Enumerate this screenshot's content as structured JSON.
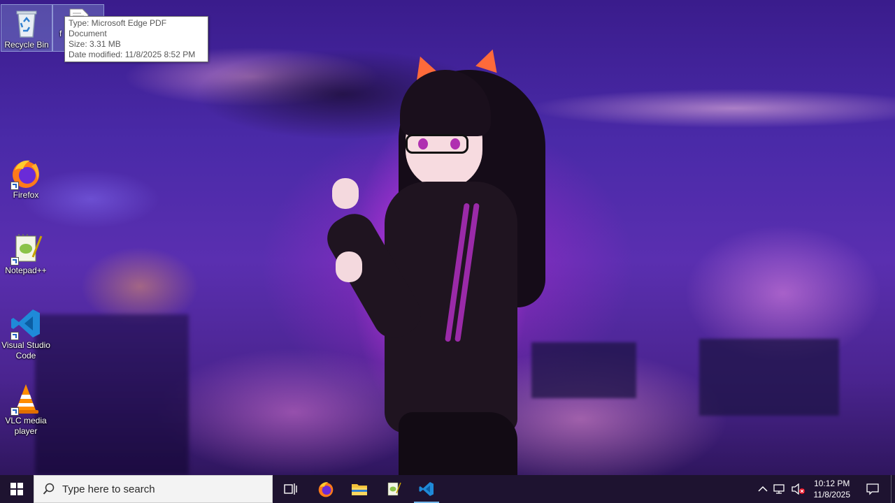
{
  "desktop": {
    "icons": [
      {
        "label": "Recycle Bin",
        "icon": "recycle-bin-icon"
      },
      {
        "label": "f",
        "icon": "pdf-file-icon"
      },
      {
        "label": "Firefox",
        "icon": "firefox-icon"
      },
      {
        "label": "Notepad++",
        "icon": "notepadpp-icon"
      },
      {
        "label": "Visual Studio Code",
        "icon": "vscode-icon"
      },
      {
        "label": "VLC media player",
        "icon": "vlc-icon"
      }
    ],
    "tooltip": {
      "type_line": "Type: Microsoft Edge PDF Document",
      "size_line": "Size: 3.31 MB",
      "date_line": "Date modified: 11/8/2025 8:52 PM"
    }
  },
  "taskbar": {
    "start": "windows-start-icon",
    "search_placeholder": "Type here to search",
    "pinned": [
      {
        "name": "task-view",
        "icon": "task-view-icon"
      },
      {
        "name": "firefox",
        "icon": "firefox-icon"
      },
      {
        "name": "file-explorer",
        "icon": "folder-icon"
      },
      {
        "name": "notepadpp",
        "icon": "notepadpp-icon"
      },
      {
        "name": "vscode",
        "icon": "vscode-icon",
        "active": true
      }
    ],
    "tray": {
      "chevron": "chevron-up-icon",
      "network": "network-icon",
      "volume": "volume-muted-icon",
      "time": "10:12 PM",
      "date": "11/8/2025",
      "notifications": "notification-icon"
    }
  },
  "colors": {
    "taskbar_bg": "#1e1330",
    "accent": "#76b9ed"
  }
}
